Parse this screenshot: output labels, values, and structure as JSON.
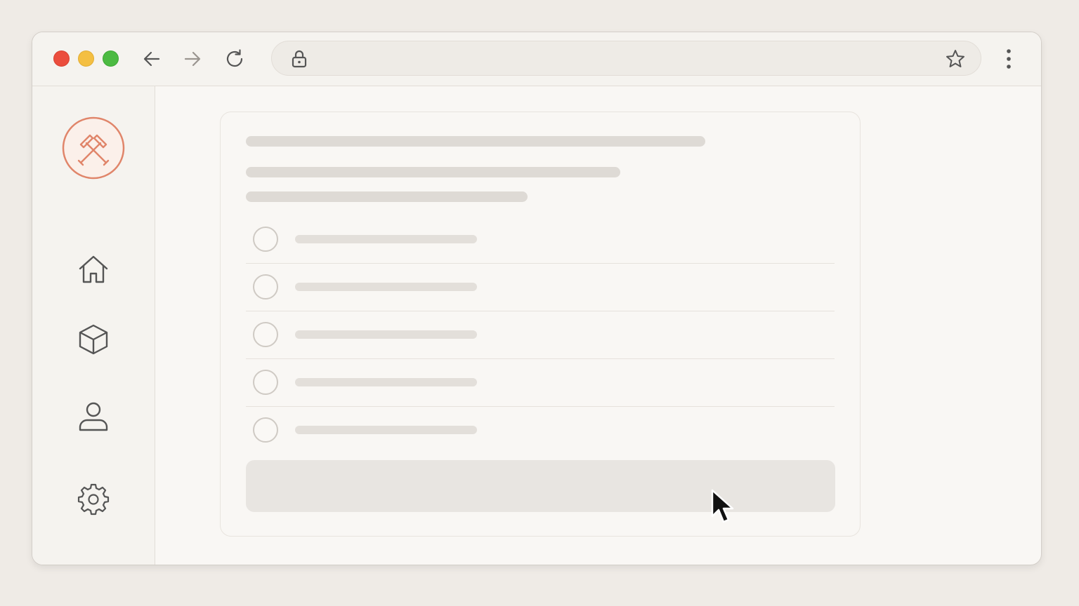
{
  "window": {
    "controls": [
      "close",
      "minimize",
      "maximize"
    ]
  },
  "toolbar": {
    "back_icon": "arrow-left-icon",
    "forward_icon": "arrow-right-icon",
    "reload_icon": "reload-icon",
    "address": {
      "url": "",
      "lock_icon": "lock-icon",
      "bookmark_icon": "star-icon"
    },
    "menu_icon": "kebab-menu-icon"
  },
  "sidebar": {
    "logo_icon": "crossed-hammers-logo",
    "items": [
      {
        "id": "home",
        "icon": "home-icon"
      },
      {
        "id": "products",
        "icon": "cube-icon"
      },
      {
        "id": "profile",
        "icon": "user-icon"
      },
      {
        "id": "settings",
        "icon": "gear-icon"
      }
    ]
  },
  "form": {
    "state": "loading-skeleton",
    "options_count_visible": 5,
    "options": [
      {
        "label": ""
      },
      {
        "label": ""
      },
      {
        "label": ""
      },
      {
        "label": ""
      },
      {
        "label": ""
      }
    ],
    "submit_label": ""
  },
  "colors": {
    "accent": "#e0856a",
    "close": "#eb4d3d",
    "minimize": "#f4bf42",
    "maximize": "#4cba42",
    "skeleton": "#dedad5",
    "background": "#efebe6"
  }
}
